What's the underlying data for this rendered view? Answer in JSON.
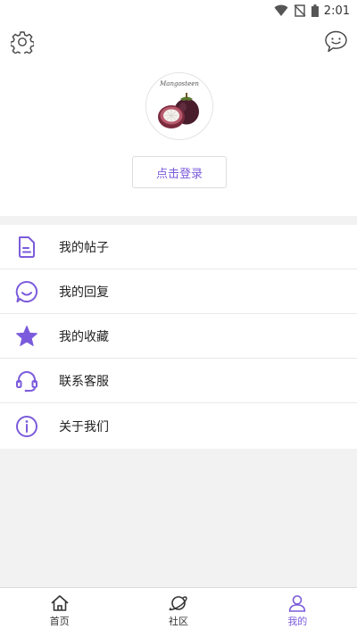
{
  "status_bar": {
    "time": "2:01"
  },
  "header": {
    "avatar_text": "Mangosteen",
    "login_label": "点击登录"
  },
  "menu": {
    "items": [
      {
        "label": "我的帖子",
        "icon": "document-icon"
      },
      {
        "label": "我的回复",
        "icon": "smile-bubble-icon"
      },
      {
        "label": "我的收藏",
        "icon": "star-icon"
      },
      {
        "label": "联系客服",
        "icon": "headset-icon"
      },
      {
        "label": "关于我们",
        "icon": "info-icon"
      }
    ]
  },
  "tabs": [
    {
      "label": "首页",
      "icon": "home-icon"
    },
    {
      "label": "社区",
      "icon": "planet-icon"
    },
    {
      "label": "我的",
      "icon": "user-icon",
      "active": true
    }
  ],
  "colors": {
    "accent": "#7b5bdc",
    "background": "#f2f2f2"
  }
}
